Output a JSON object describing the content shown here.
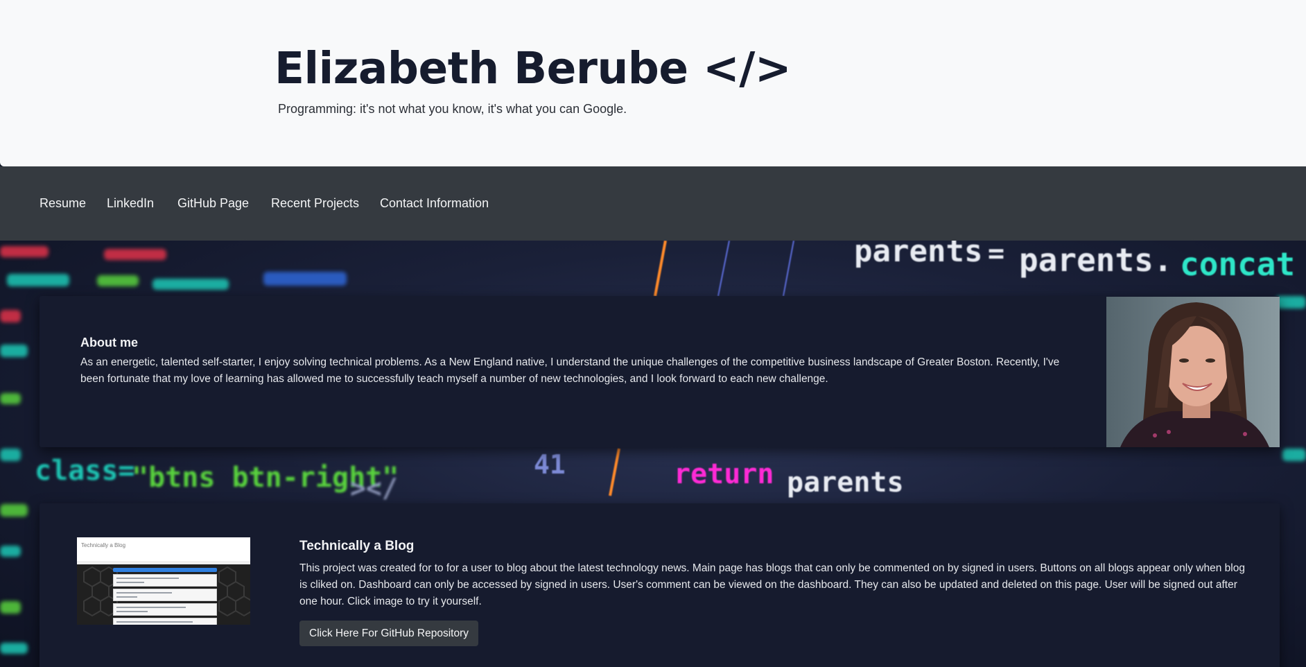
{
  "header": {
    "title": "Elizabeth Berube </>",
    "tagline": "Programming: it's not what you know, it's what you can Google."
  },
  "nav": {
    "items": [
      {
        "label": "Resume"
      },
      {
        "label": "LinkedIn"
      },
      {
        "label": "GitHub Page"
      },
      {
        "label": "Recent Projects"
      },
      {
        "label": "Contact Information"
      }
    ]
  },
  "background_code": {
    "line1": "parents = parents.concat",
    "line2_number": "41",
    "line2_keyword": "return",
    "line2_rest": "parents",
    "left_snippet": "class=\"btns btn-right\"",
    "keyword_color": "#ff2bd6",
    "accent_color": "#2ee6c8"
  },
  "about": {
    "title": "About me",
    "text": "As an energetic, talented self-starter, I enjoy solving technical problems. As a New England native, I understand the unique challenges of the competitive business landscape of Greater Boston. Recently, I've been fortunate that my love of learning has allowed me to successfully teach myself a number of new technologies, and I look forward to each new challenge."
  },
  "project": {
    "thumb_title": "Technically a Blog",
    "title": "Technically a Blog",
    "text": "This project was created for to for a user to blog about the latest technology news. Main page has blogs that can only be commented on by signed in users. Buttons on all blogs appear only when blog is cliked on. Dashboard can only be accessed by signed in users. User's comment can be viewed on the dashboard. They can also be updated and deleted on this page. User will be signed out after one hour. Click image to try it yourself.",
    "button_label": "Click Here For GitHub Repository"
  },
  "colors": {
    "header_bg": "#f8f9fa",
    "nav_bg": "#353a40",
    "card_bg": "#161b2e",
    "button_bg": "#353a40"
  }
}
